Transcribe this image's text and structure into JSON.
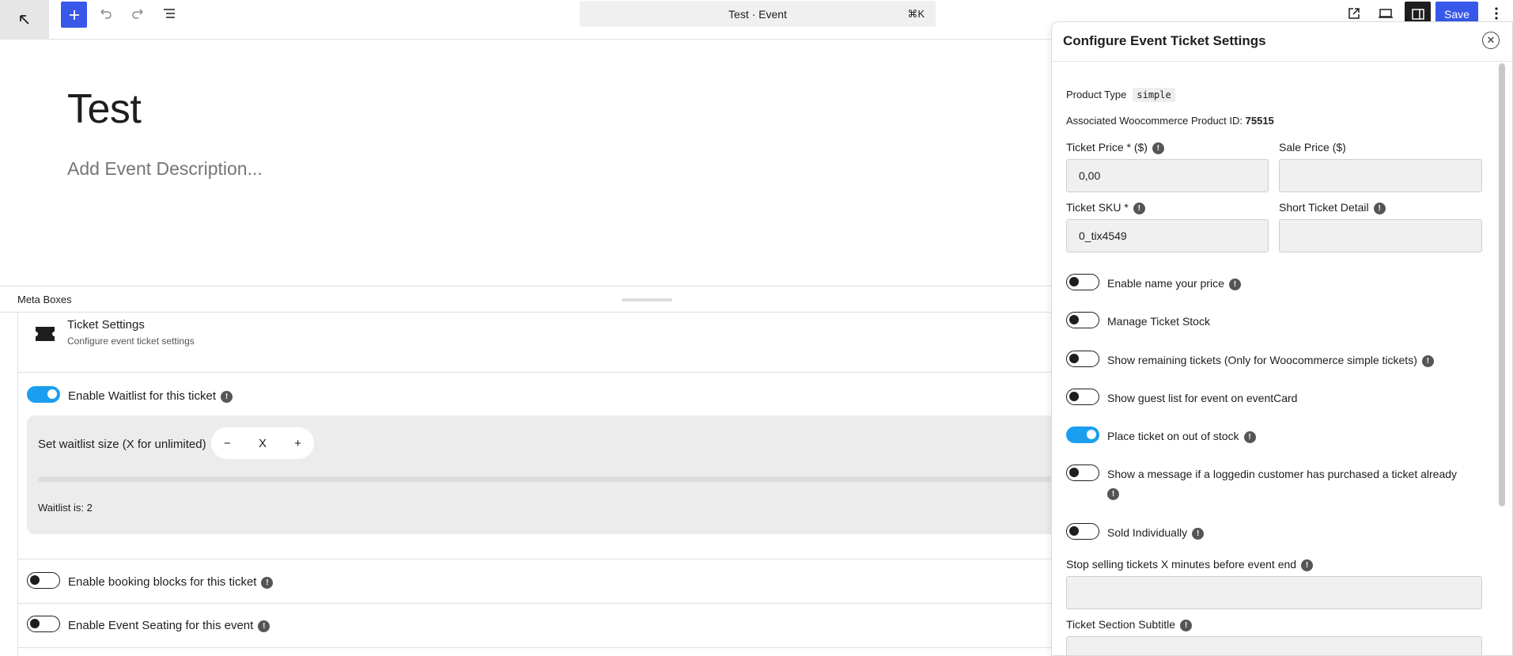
{
  "toolbar": {
    "document_title": "Test · Event",
    "shortcut": "⌘K",
    "save_label": "Save"
  },
  "editor": {
    "title": "Test",
    "description_placeholder": "Add Event Description..."
  },
  "meta_boxes": {
    "header": "Meta Boxes",
    "ticket_settings": {
      "title": "Ticket Settings",
      "subtitle": "Configure event ticket settings"
    },
    "waitlist": {
      "label": "Enable Waitlist for this ticket",
      "enabled": true,
      "size_label": "Set waitlist size (X for unlimited)",
      "size_value": "X",
      "status": "Waitlist is: 2"
    },
    "booking_blocks": {
      "label": "Enable booking blocks for this ticket",
      "enabled": false
    },
    "event_seating": {
      "label": "Enable Event Seating for this event",
      "enabled": false
    }
  },
  "panel": {
    "title": "Configure Event Ticket Settings",
    "product_type_label": "Product Type",
    "product_type_value": "simple",
    "product_id_label": "Associated Woocommerce Product ID:",
    "product_id_value": "75515",
    "ticket_price_label": "Ticket Price * ($)",
    "ticket_price_value": "0,00",
    "sale_price_label": "Sale Price ($)",
    "sale_price_value": "",
    "sku_label": "Ticket SKU *",
    "sku_value": "0_tix4549",
    "short_detail_label": "Short Ticket Detail",
    "short_detail_value": "",
    "toggles": [
      {
        "label": "Enable name your price",
        "on": false,
        "info": true
      },
      {
        "label": "Manage Ticket Stock",
        "on": false,
        "info": false
      },
      {
        "label": "Show remaining tickets (Only for Woocommerce simple tickets)",
        "on": false,
        "info": true
      },
      {
        "label": "Show guest list for event on eventCard",
        "on": false,
        "info": false
      },
      {
        "label": "Place ticket on out of stock",
        "on": true,
        "info": true
      },
      {
        "label": "Show a message if a loggedin customer has purchased a ticket already",
        "on": false,
        "info": true
      },
      {
        "label": "Sold Individually",
        "on": false,
        "info": true
      }
    ],
    "stop_selling_label": "Stop selling tickets X minutes before event end",
    "stop_selling_value": "",
    "section_subtitle_label": "Ticket Section Subtitle"
  }
}
